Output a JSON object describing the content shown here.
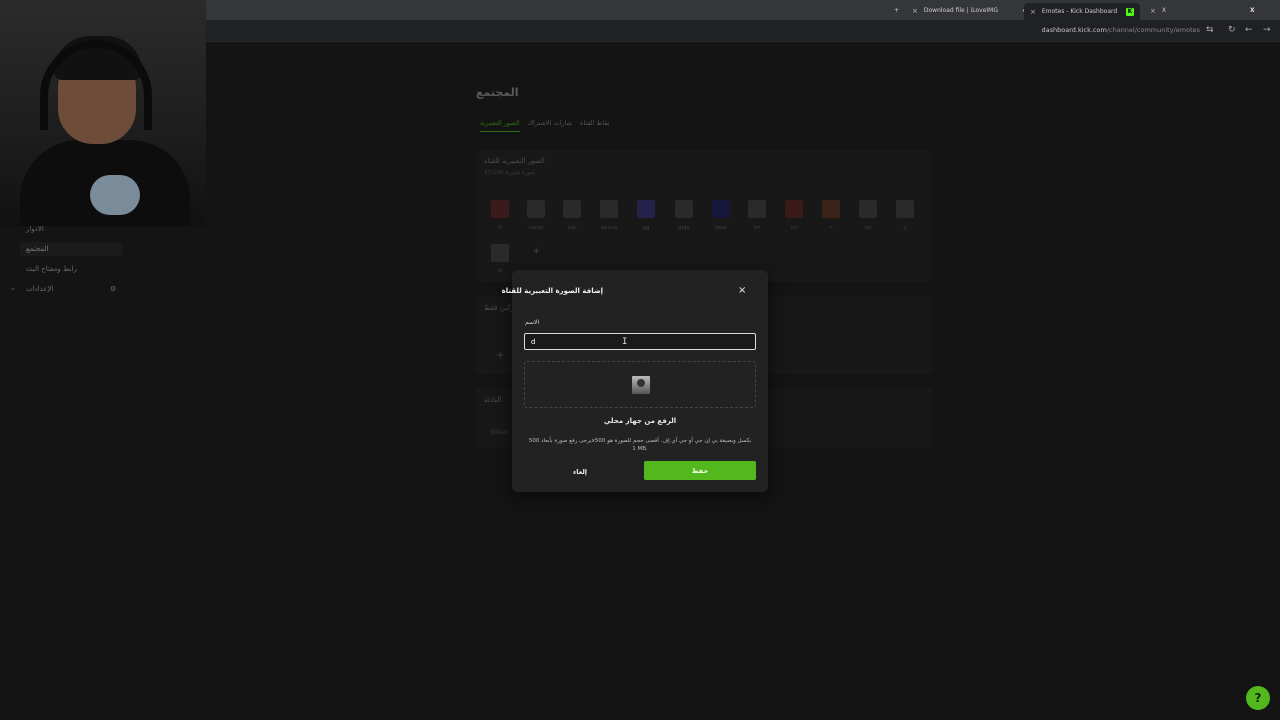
{
  "browser": {
    "tabs": [
      {
        "label": "Download file | iLoveIMG",
        "close": "×"
      },
      {
        "label": "Emotes - Kick Dashboard",
        "close": "×"
      }
    ],
    "new_tab": "+",
    "x_tab": "X",
    "url_domain": "dashboard.kick.com",
    "url_path": "/channel/community/emotes"
  },
  "sidebar": {
    "items": [
      {
        "label": "الأدوار"
      },
      {
        "label": "المجتمع"
      },
      {
        "label": "رابط ومفتاح البث"
      },
      {
        "label": "الإعدادات"
      }
    ]
  },
  "page": {
    "title": "المجتمع",
    "tabs": [
      {
        "label": "الصور التعبيرية",
        "active": true
      },
      {
        "label": "شارات الاشتراك",
        "active": false
      },
      {
        "label": "نقاط القناة",
        "active": false
      }
    ],
    "emotes_card": {
      "title": "الصور التعبيرية للقناة",
      "subtitle": "47/100 صورة تعبيرية",
      "emotes": [
        "b",
        "camp",
        "cat",
        "dance",
        "gg",
        "giga",
        "heat",
        "im",
        "lol",
        "n",
        "no",
        "o",
        "st"
      ]
    },
    "subs_card_title": "مركبن فقط",
    "misc_card_title": "البادئة",
    "misc_input": "Shtad"
  },
  "modal": {
    "title": "إضافة الصورة التعبيرية للقناة",
    "close": "×",
    "name_label": "الاسم",
    "name_value": "d",
    "upload_label": "الرفع من جهاز محلي",
    "hint": "يرجى رفع صورة بأبعاد 500x500 بكسل وبصيغة بي إن جي أو جي آي إف. أقصى حجم للصورة هو 1 MB.",
    "cancel": "إلغاء",
    "save": "حفظ"
  },
  "colors": {
    "accent": "#53b81e",
    "modal_bg": "#222222",
    "page_bg": "#141414"
  }
}
